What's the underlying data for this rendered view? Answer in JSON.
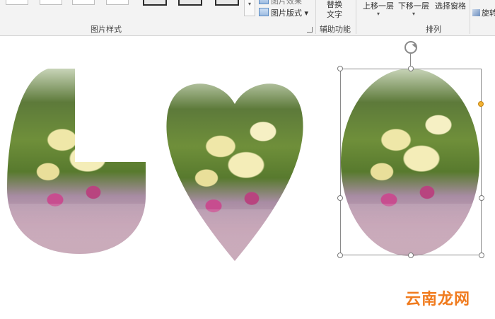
{
  "ribbon": {
    "picture_styles": {
      "group_label": "图片样式",
      "scroll_glyph": "▾",
      "truncated_button_label": "图片效果",
      "layout_button_label": "图片版式",
      "layout_dropdown_glyph": "▾"
    },
    "accessibility": {
      "group_label": "辅助功能",
      "alt_text_line1": "替换",
      "alt_text_line2": "文字"
    },
    "arrange": {
      "group_label": "排列",
      "bring_forward_label": "上移一层",
      "send_backward_label": "下移一层",
      "dropdown_glyph": "▾",
      "selection_pane_label": "选择窗格",
      "rotate_label": "旋转"
    }
  },
  "canvas": {
    "shapes": [
      {
        "name": "L-shaped picture",
        "icon": "photo-bouquet"
      },
      {
        "name": "heart-shaped picture",
        "icon": "photo-bouquet"
      },
      {
        "name": "oval picture (selected)",
        "icon": "photo-bouquet"
      }
    ]
  },
  "watermark": "云南龙网",
  "colors": {
    "ribbon_bg": "#f3f3f3",
    "adjust_handle": "#f2b233",
    "watermark": "#f07b1e"
  }
}
